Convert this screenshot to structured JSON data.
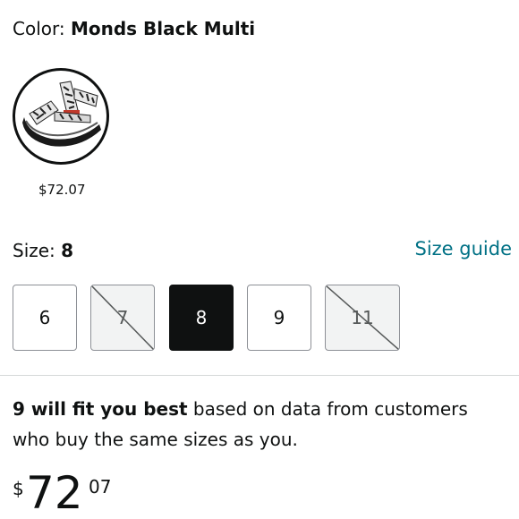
{
  "color": {
    "label": "Color: ",
    "value": "Monds Black Multi"
  },
  "swatch": {
    "price": "$72.07"
  },
  "size": {
    "label": "Size: ",
    "value": "8",
    "guide_link": "Size guide"
  },
  "size_options": [
    {
      "label": "6",
      "state": "available"
    },
    {
      "label": "7",
      "state": "unavailable"
    },
    {
      "label": "8",
      "state": "selected"
    },
    {
      "label": "9",
      "state": "available"
    },
    {
      "label": "11",
      "state": "unavailable"
    }
  ],
  "fit": {
    "bold": "9 will fit you best",
    "rest": " based on data from customers who buy the same sizes as you."
  },
  "price": {
    "symbol": "$",
    "whole": "72",
    "fraction": "07"
  },
  "colors": {
    "link": "#007185",
    "selected": "#0f1111",
    "unavailable": "#f2f3f3"
  }
}
